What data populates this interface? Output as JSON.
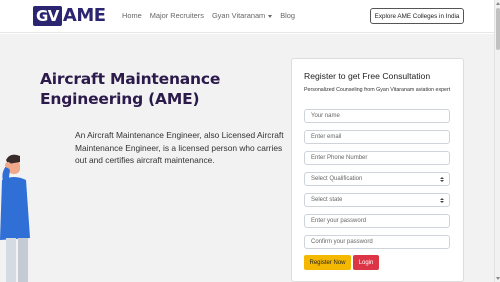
{
  "navbar": {
    "logo_gv": "GV",
    "logo_ame": "AME",
    "links": [
      "Home",
      "Major Recruiters",
      "Gyan Vitaranam",
      "Blog"
    ],
    "explore_button": "Explore AME Colleges in India"
  },
  "hero": {
    "title": "Aircraft Maintenance Engineering (AME)",
    "description": "An Aircraft Maintenance Engineer, also Licensed Aircraft Maintenance Engineer, is a licensed person who carries out and certifies aircraft maintenance."
  },
  "form": {
    "title": "Register to get Free Consultation",
    "subtitle": "Personalized Counseling from Gyan Vitaranam aviation expert",
    "name_placeholder": "Your name",
    "email_placeholder": "Enter email",
    "phone_placeholder": "Enter Phone Number",
    "qualification_selected": "Select Qualification",
    "state_selected": "Select state",
    "password_placeholder": "Enter your password",
    "confirm_password_placeholder": "Confirm your password",
    "register_button": "Register Now",
    "login_button": "Login"
  },
  "colors": {
    "brand": "#2b2470",
    "register": "#f5b800",
    "login": "#dc3545"
  }
}
